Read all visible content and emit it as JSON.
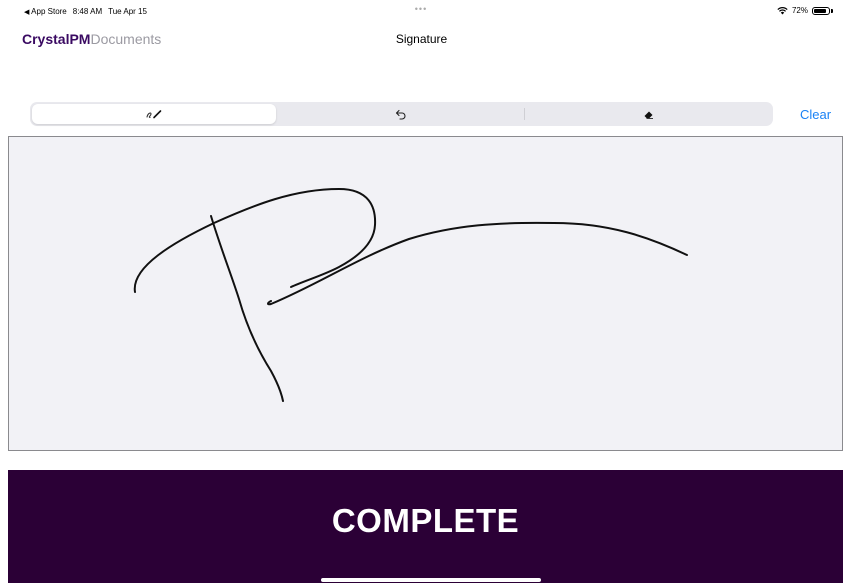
{
  "status": {
    "back_app": "App Store",
    "time": "8:48 AM",
    "date": "Tue Apr 15",
    "dots": "•••",
    "battery": "72%"
  },
  "header": {
    "brand_bold": "CrystalPM",
    "brand_light": "Documents",
    "title": "Signature"
  },
  "toolbar": {
    "tools": [
      {
        "name": "pen",
        "icon": "pen-icon",
        "selected": true
      },
      {
        "name": "undo",
        "icon": "undo-icon",
        "selected": false
      },
      {
        "name": "eraser",
        "icon": "eraser-icon",
        "selected": false
      }
    ],
    "clear_label": "Clear"
  },
  "complete": {
    "label": "COMPLETE"
  },
  "colors": {
    "brand": "#3a0a62",
    "complete_bg": "#2b0036",
    "link": "#1a82f5",
    "canvas_bg": "#f2f2f6"
  }
}
